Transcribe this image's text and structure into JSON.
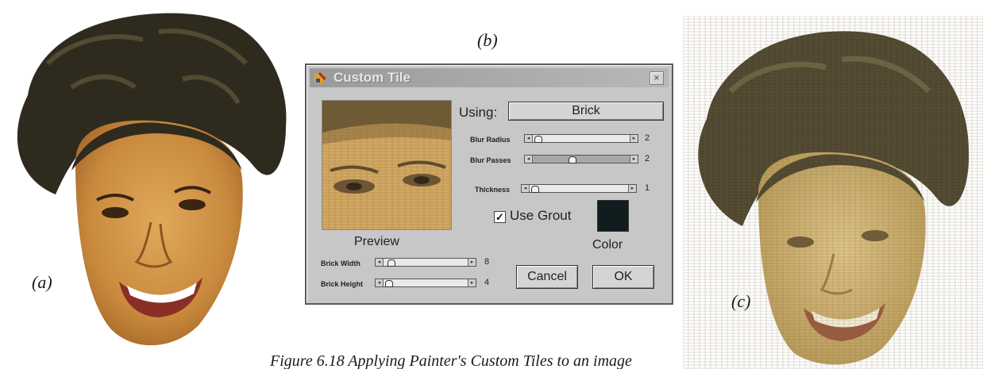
{
  "labels": {
    "b": "(b)",
    "a": "(a)",
    "c": "(c)"
  },
  "caption": "Figure 6.18  Applying Painter's Custom Tiles to an image",
  "dialog": {
    "title": "Custom Tile",
    "close": "×",
    "using_label": "Using:",
    "using_value": "Brick",
    "preview_label": "Preview",
    "sliders": {
      "blur_radius": {
        "label": "Blur Radius",
        "value": "2",
        "level": 0.02
      },
      "blur_passes": {
        "label": "Blur Passes",
        "value": "2",
        "level": 0.4
      },
      "thickness": {
        "label": "Thickness",
        "value": "1",
        "level": 0.02
      },
      "brick_width": {
        "label": "Brick Width",
        "value": "8",
        "level": 0.05
      },
      "brick_height": {
        "label": "Brick Height",
        "value": "4",
        "level": 0.02
      }
    },
    "use_grout": {
      "label": "Use Grout",
      "checked": "✓"
    },
    "color_label": "Color",
    "cancel": "Cancel",
    "ok": "OK"
  }
}
